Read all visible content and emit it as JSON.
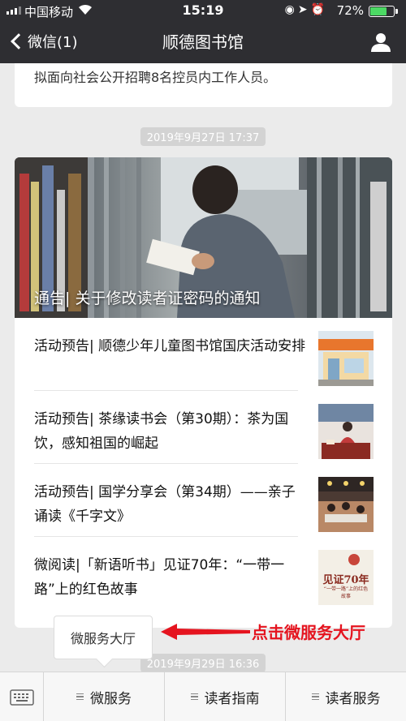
{
  "status_bar": {
    "carrier": "中国移动",
    "time": "15:19",
    "battery_percent": "72%",
    "battery_level": 0.72
  },
  "nav": {
    "back_label": "微信(1)",
    "title": "顺德图书馆"
  },
  "feed": {
    "prev_card_text": "拟面向社会公开招聘8名控员内工作人员。",
    "timestamp_1": "2019年9月27日 17:37",
    "main_article_title": "通告| 关于修改读者证密码的通知",
    "sub_articles": [
      {
        "title": "活动预告| 顺德少年儿童图书馆国庆活动安排"
      },
      {
        "title": "活动预告| 茶缘读书会（第30期）：茶为国饮，感知祖国的崛起"
      },
      {
        "title": "活动预告| 国学分享会（第34期）——亲子诵读《千字文》"
      },
      {
        "title": "微阅读|「新语听书」见证70年：“一带一路”上的红色故事"
      }
    ],
    "thumb4_text": "见证70年",
    "thumb4_sub": "“一带一路”上的红色故事",
    "timestamp_2": "2019年9月29日 16:36"
  },
  "popup": {
    "label": "微服务大厅"
  },
  "annotation": {
    "text": "点击微服务大厅",
    "color": "#e5141f"
  },
  "bottom_menu": {
    "items": [
      "微服务",
      "读者指南",
      "读者服务"
    ]
  },
  "colors": {
    "nav_bg": "#2e2e32",
    "page_bg": "#ebebeb",
    "battery": "#4cd964"
  }
}
